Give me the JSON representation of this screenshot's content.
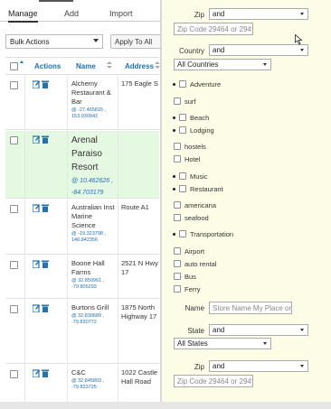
{
  "tabs": [
    {
      "label": "Manage"
    },
    {
      "label": "Add"
    },
    {
      "label": "Import"
    }
  ],
  "bulk": {
    "select_value": "Bulk Actions",
    "apply_label": "Apply  To All"
  },
  "table": {
    "headers": {
      "actions": "Actions",
      "name": "Name",
      "address": "Address"
    },
    "rows": [
      {
        "name": "Alchemy Restaurant & Bar",
        "coords": "@ -27.465815 , 153.030942",
        "address": "175 Eagle S"
      },
      {
        "name": "Arenal Paraiso Resort",
        "coords": "@ 10.462626 , -84.703179",
        "address": ""
      },
      {
        "name": "Australian Inst Marine Science",
        "coords": "@ -19.323798 , 146.842356",
        "address": "Route A1"
      },
      {
        "name": "Boone Hall Farms",
        "coords": "@ 32.850961 , -79.805293",
        "address": "2521 N Hwy 17"
      },
      {
        "name": "Burtons Grill",
        "coords": "@ 32.830689 , -79.830772",
        "address": "1875 North Highway 17"
      },
      {
        "name": "C&C",
        "coords": "@ 32.845803 , -79.833725",
        "address": "1022 Castle Hall Road"
      }
    ]
  },
  "filters": {
    "zip_label": "Zip",
    "zip_op": "and",
    "zip_placeholder": "Zip Code 29464 or 294*",
    "country_label": "Country",
    "country_op": "and",
    "country_value": "All Countries",
    "categories": [
      {
        "label": "Adventure"
      },
      {
        "label": "surf"
      },
      {
        "label": "Beach"
      },
      {
        "label": "Lodging"
      },
      {
        "label": "hostels"
      },
      {
        "label": "Hotel"
      },
      {
        "label": "Music"
      },
      {
        "label": "Restaurant"
      },
      {
        "label": "americana"
      },
      {
        "label": "seafood"
      },
      {
        "label": "Transportation"
      },
      {
        "label": "Airport"
      },
      {
        "label": "auto rental"
      },
      {
        "label": "Bus"
      },
      {
        "label": "Ferry"
      }
    ],
    "name_label": "Name",
    "name_placeholder": "Store Name My Place or",
    "state_label": "State",
    "state_op": "and",
    "state_value": "All States",
    "zip2_label": "Zip",
    "zip2_op": "and",
    "zip2_placeholder": "Zip Code 29464 or 294*"
  },
  "icons": {
    "edit": "edit-icon",
    "delete": "trash-icon",
    "cursor": "mouse-pointer-icon"
  },
  "colors": {
    "link": "#2271b1",
    "highlight_row": "#e5f8e1",
    "panel_bg": "#fdfde7"
  }
}
